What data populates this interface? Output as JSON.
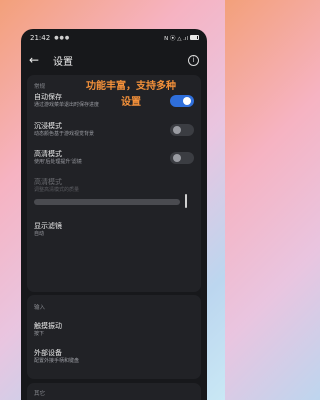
{
  "status": {
    "time": "21:42",
    "icons": "●●●",
    "right_icons": "N ⦿ △ .ıl"
  },
  "appbar": {
    "back_icon": "←",
    "title": "设置",
    "info_icon": "i"
  },
  "overlay": {
    "line1": "功能丰富，支持多种",
    "line2": "设置"
  },
  "sections": {
    "general": {
      "title": "常规",
      "autosave": {
        "label": "自动保存",
        "sub": "通过游戏菜单退出时保存进度",
        "on": true
      },
      "immersive": {
        "label": "沉浸模式",
        "sub": "动态颜色基于游戏视觉背景",
        "on": false
      },
      "hd": {
        "label": "高清模式",
        "sub": "使用'后处理提升'滤镜",
        "on": false
      },
      "hd_quality": {
        "label": "高清模式",
        "sub": "调整高清模式的质量",
        "value": 1.0
      },
      "filter": {
        "label": "显示滤镜",
        "sub": "自动"
      }
    },
    "input": {
      "title": "输入",
      "haptics": {
        "label": "触摸振动",
        "sub": "按下"
      },
      "devices": {
        "label": "外部设备",
        "sub": "配置外接手柄和键盘"
      }
    },
    "other": {
      "title": "其它"
    }
  }
}
